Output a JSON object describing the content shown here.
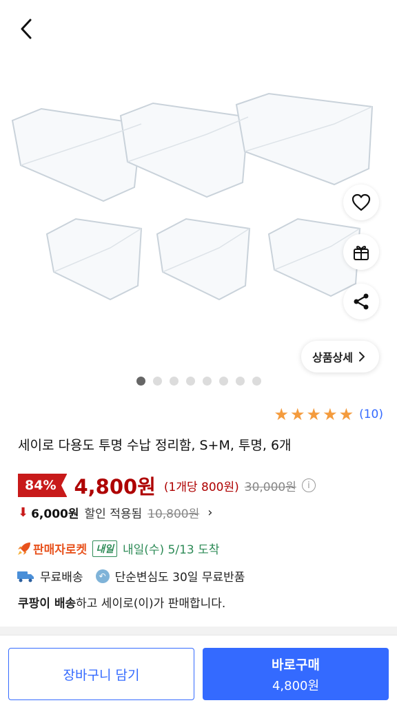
{
  "header": {
    "back_icon": "chevron-left-icon"
  },
  "gallery": {
    "dots_total": 8,
    "dots_active": 1,
    "detail_label": "상품상세",
    "actions": [
      "heart-icon",
      "gift-icon",
      "share-icon"
    ]
  },
  "product": {
    "rating_stars": 5,
    "review_count": "(10)",
    "title": "세이로 다용도 투명 수납 정리함, S+M, 투명, 6개"
  },
  "price": {
    "discount": "84%",
    "sale": "4,800원",
    "unit": "(1개당 800원)",
    "original": "30,000원"
  },
  "coupon": {
    "amount": "6,000원",
    "text": "할인 적용됨",
    "original": "10,800원"
  },
  "delivery": {
    "rocket_label": "판매자로켓",
    "tomorrow_badge": "내일",
    "arrival": "내일(수) 5/13 도착",
    "free_shipping": "무료배송",
    "free_return": "단순변심도 30일 무료반품"
  },
  "seller": {
    "bold": "쿠팡이 배송",
    "rest": "하고 세이로(이)가 판매합니다."
  },
  "bottom": {
    "cart_label": "장바구니 담기",
    "buy_label": "바로구매",
    "buy_price": "4,800원"
  },
  "colors": {
    "accent": "#346aff",
    "price_red": "#ae0000",
    "badge_red": "#c81a1a",
    "star": "#f49b3d",
    "rocket_green": "#2e8b57"
  }
}
